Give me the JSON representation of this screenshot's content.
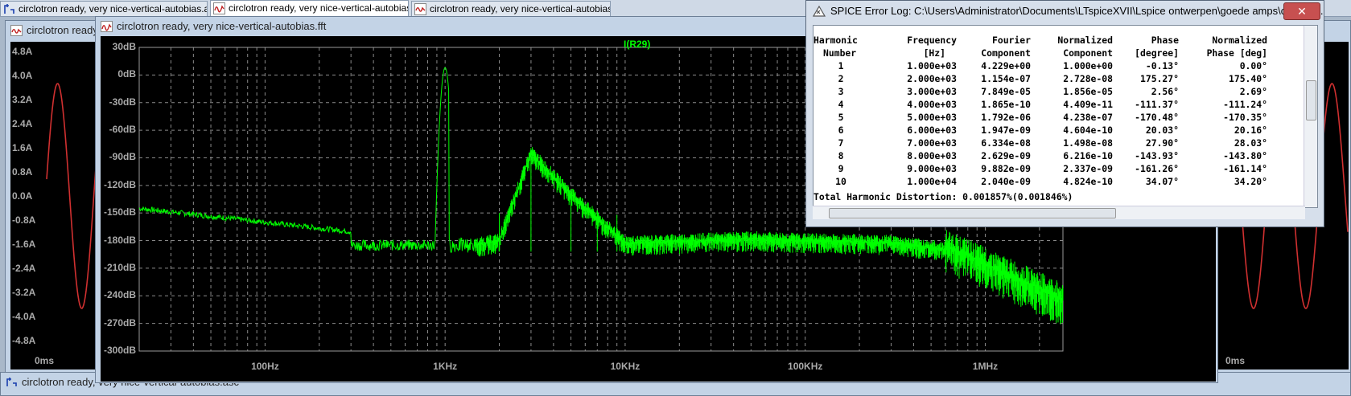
{
  "tabs": [
    {
      "label": "circlotron ready, very nice-vertical-autobias.asc",
      "icon": "schematic-icon"
    },
    {
      "label": "circlotron ready, very nice-vertical-autobias.fft",
      "icon": "fft-waveform-icon"
    },
    {
      "label": "circlotron ready, very nice-vertical-autobias.raw",
      "icon": "waveform-icon"
    }
  ],
  "left_window": {
    "title": "circlotron ready, very nice-vertical-autobias.raw",
    "y_ticks": [
      "4.8A",
      "4.0A",
      "3.2A",
      "2.4A",
      "1.6A",
      "0.8A",
      "0.0A",
      "-0.8A",
      "-1.6A",
      "-2.4A",
      "-3.2A",
      "-4.0A",
      "-4.8A"
    ],
    "x_tick": "0ms",
    "trace_color": "#d03030"
  },
  "right_window": {
    "x_tick": "0ms"
  },
  "fft_window": {
    "title": "circlotron ready, very nice-vertical-autobias.fft",
    "trace_label": "I(R29)",
    "trace_color": "#00ff00",
    "y_ticks": [
      "30dB",
      "0dB",
      "-30dB",
      "-60dB",
      "-90dB",
      "-120dB",
      "-150dB",
      "-180dB",
      "-210dB",
      "-240dB",
      "-270dB",
      "-300dB"
    ],
    "x_ticks": [
      "100Hz",
      "1KHz",
      "10KHz",
      "100KHz",
      "1MHz"
    ]
  },
  "chart_data": {
    "type": "line",
    "xlabel": "",
    "ylabel": "",
    "x_scale": "log",
    "ylim": [
      -300,
      30
    ],
    "series": [
      {
        "name": "I(R29)",
        "x": [
          20,
          50,
          100,
          200,
          300,
          500,
          700,
          900,
          1000,
          1100,
          1500,
          2000,
          3000,
          5000,
          10000,
          50000,
          100000,
          300000,
          1000000,
          2000000,
          2700000
        ],
        "y": [
          -145,
          -155,
          -165,
          -178,
          -188,
          -185,
          -190,
          -170,
          8,
          -170,
          -185,
          -180,
          -85,
          -130,
          -183,
          -178,
          -180,
          -182,
          -195,
          -240,
          -250
        ]
      }
    ]
  },
  "bottom_window": {
    "title": "circlotron ready, very nice-vertical-autobias.asc"
  },
  "error_log": {
    "title": "SPICE Error Log: C:\\Users\\Administrator\\Documents\\LTspiceXVII\\Lspice ontwerpen\\goede amps\\circlotro...",
    "close_label": "✕",
    "header1": [
      "Harmonic",
      "Frequency",
      "Fourier",
      "Normalized",
      "Phase",
      "Normalized"
    ],
    "header2": [
      "Number",
      "[Hz]",
      "Component",
      "Component",
      "[degree]",
      "Phase [deg]"
    ],
    "rows": [
      [
        "1",
        "1.000e+03",
        "4.229e+00",
        "1.000e+00",
        "-0.13°",
        "0.00°"
      ],
      [
        "2",
        "2.000e+03",
        "1.154e-07",
        "2.728e-08",
        "175.27°",
        "175.40°"
      ],
      [
        "3",
        "3.000e+03",
        "7.849e-05",
        "1.856e-05",
        "2.56°",
        "2.69°"
      ],
      [
        "4",
        "4.000e+03",
        "1.865e-10",
        "4.409e-11",
        "-111.37°",
        "-111.24°"
      ],
      [
        "5",
        "5.000e+03",
        "1.792e-06",
        "4.238e-07",
        "-170.48°",
        "-170.35°"
      ],
      [
        "6",
        "6.000e+03",
        "1.947e-09",
        "4.604e-10",
        "20.03°",
        "20.16°"
      ],
      [
        "7",
        "7.000e+03",
        "6.334e-08",
        "1.498e-08",
        "27.90°",
        "28.03°"
      ],
      [
        "8",
        "8.000e+03",
        "2.629e-09",
        "6.216e-10",
        "-143.93°",
        "-143.80°"
      ],
      [
        "9",
        "9.000e+03",
        "9.882e-09",
        "2.337e-09",
        "-161.26°",
        "-161.14°"
      ],
      [
        "10",
        "1.000e+04",
        "2.040e-09",
        "4.824e-10",
        "34.07°",
        "34.20°"
      ]
    ],
    "thd_line": "Total Harmonic Distortion: 0.001857%(0.001846%)"
  }
}
